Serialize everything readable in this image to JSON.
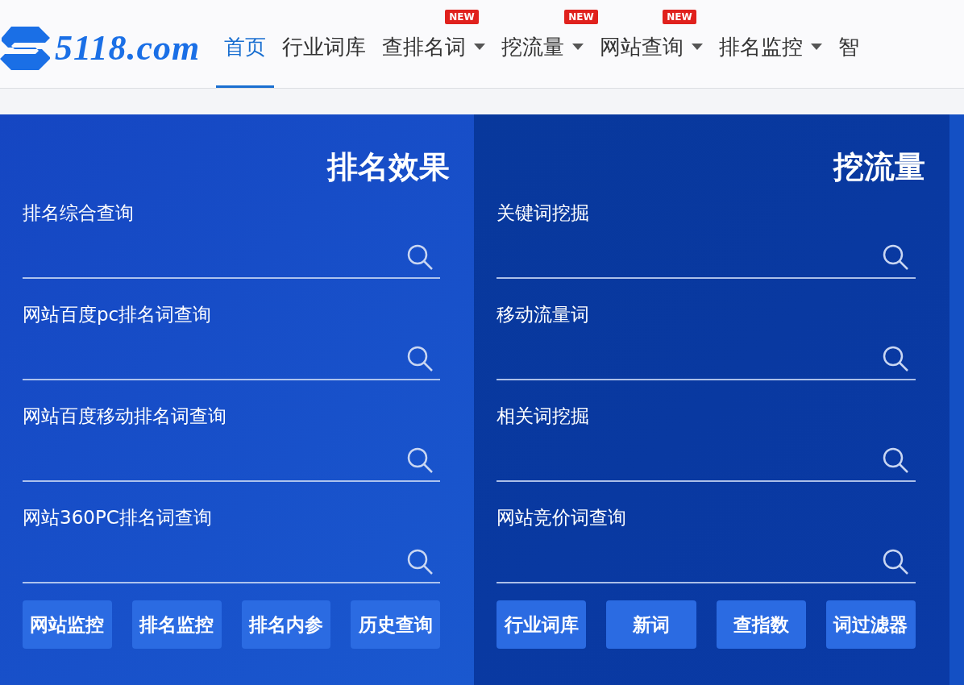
{
  "logo": {
    "text": "5118.com"
  },
  "nav": [
    {
      "label": "首页",
      "selected": true,
      "dropdown": false
    },
    {
      "label": "行业词库",
      "selected": false,
      "dropdown": false
    },
    {
      "label": "查排名词",
      "selected": false,
      "dropdown": true,
      "badge": "NEW"
    },
    {
      "label": "挖流量",
      "selected": false,
      "dropdown": true,
      "badge": "NEW"
    },
    {
      "label": "网站查询",
      "selected": false,
      "dropdown": true,
      "badge": "NEW"
    },
    {
      "label": "排名监控",
      "selected": false,
      "dropdown": true
    },
    {
      "label": "智",
      "selected": false,
      "dropdown": false
    }
  ],
  "panels": [
    {
      "title": "排名效果",
      "fields": [
        "排名综合查询",
        "网站百度pc排名词查询",
        "网站百度移动排名词查询",
        "网站360PC排名词查询"
      ],
      "buttons": [
        "网站监控",
        "排名监控",
        "排名内参",
        "历史查询"
      ]
    },
    {
      "title": "挖流量",
      "fields": [
        "关键词挖掘",
        "移动流量词",
        "相关词挖掘",
        "网站竞价词查询"
      ],
      "buttons": [
        "行业词库",
        "新词",
        "查指数",
        "词过滤器"
      ]
    }
  ]
}
